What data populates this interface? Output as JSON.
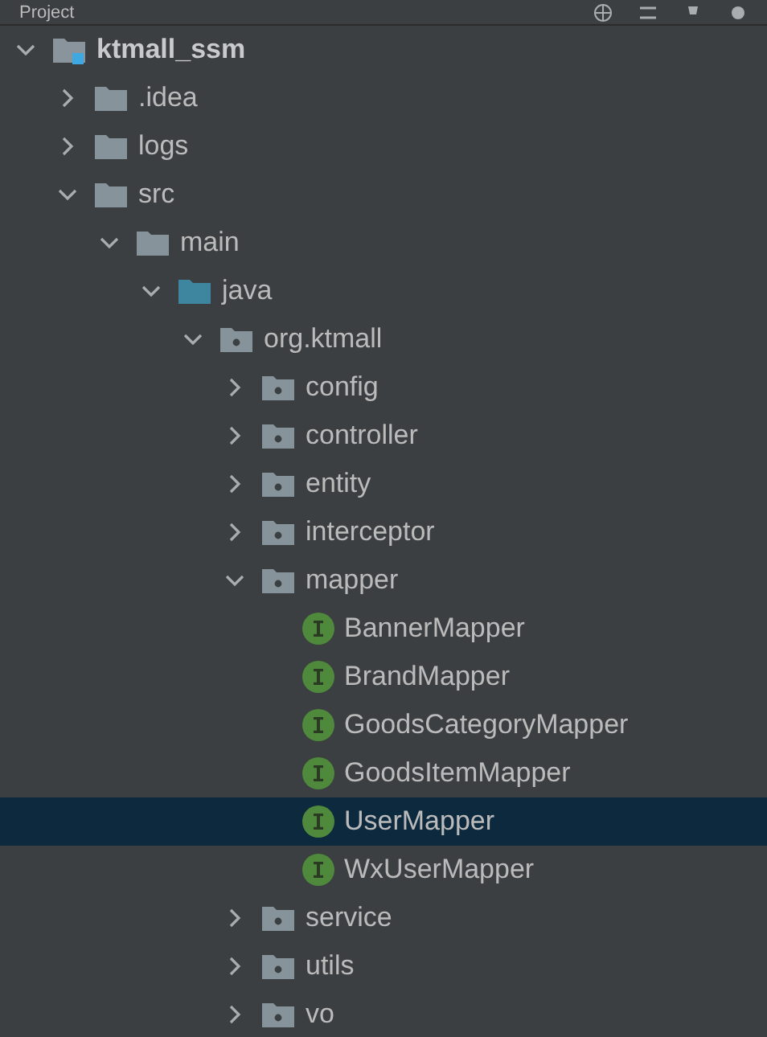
{
  "panel": {
    "title": "Project"
  },
  "tree": [
    {
      "label": "ktmall_ssm",
      "kind": "module",
      "expanded": true,
      "selected": false,
      "children": [
        {
          "label": ".idea",
          "kind": "folder",
          "expanded": false,
          "selected": false
        },
        {
          "label": "logs",
          "kind": "folder",
          "expanded": false,
          "selected": false
        },
        {
          "label": "src",
          "kind": "folder",
          "expanded": true,
          "selected": false,
          "children": [
            {
              "label": "main",
              "kind": "folder",
              "expanded": true,
              "selected": false,
              "children": [
                {
                  "label": "java",
                  "kind": "source",
                  "expanded": true,
                  "selected": false,
                  "children": [
                    {
                      "label": "org.ktmall",
                      "kind": "package",
                      "expanded": true,
                      "selected": false,
                      "children": [
                        {
                          "label": "config",
                          "kind": "package",
                          "expanded": false,
                          "selected": false
                        },
                        {
                          "label": "controller",
                          "kind": "package",
                          "expanded": false,
                          "selected": false
                        },
                        {
                          "label": "entity",
                          "kind": "package",
                          "expanded": false,
                          "selected": false
                        },
                        {
                          "label": "interceptor",
                          "kind": "package",
                          "expanded": false,
                          "selected": false
                        },
                        {
                          "label": "mapper",
                          "kind": "package",
                          "expanded": true,
                          "selected": false,
                          "children": [
                            {
                              "label": "BannerMapper",
                              "kind": "interface",
                              "selected": false
                            },
                            {
                              "label": "BrandMapper",
                              "kind": "interface",
                              "selected": false
                            },
                            {
                              "label": "GoodsCategoryMapper",
                              "kind": "interface",
                              "selected": false
                            },
                            {
                              "label": "GoodsItemMapper",
                              "kind": "interface",
                              "selected": false
                            },
                            {
                              "label": "UserMapper",
                              "kind": "interface",
                              "selected": true
                            },
                            {
                              "label": "WxUserMapper",
                              "kind": "interface",
                              "selected": false
                            }
                          ]
                        },
                        {
                          "label": "service",
                          "kind": "package",
                          "expanded": false,
                          "selected": false
                        },
                        {
                          "label": "utils",
                          "kind": "package",
                          "expanded": false,
                          "selected": false
                        },
                        {
                          "label": "vo",
                          "kind": "package",
                          "expanded": false,
                          "selected": false
                        }
                      ]
                    }
                  ]
                }
              ]
            }
          ]
        }
      ]
    }
  ]
}
